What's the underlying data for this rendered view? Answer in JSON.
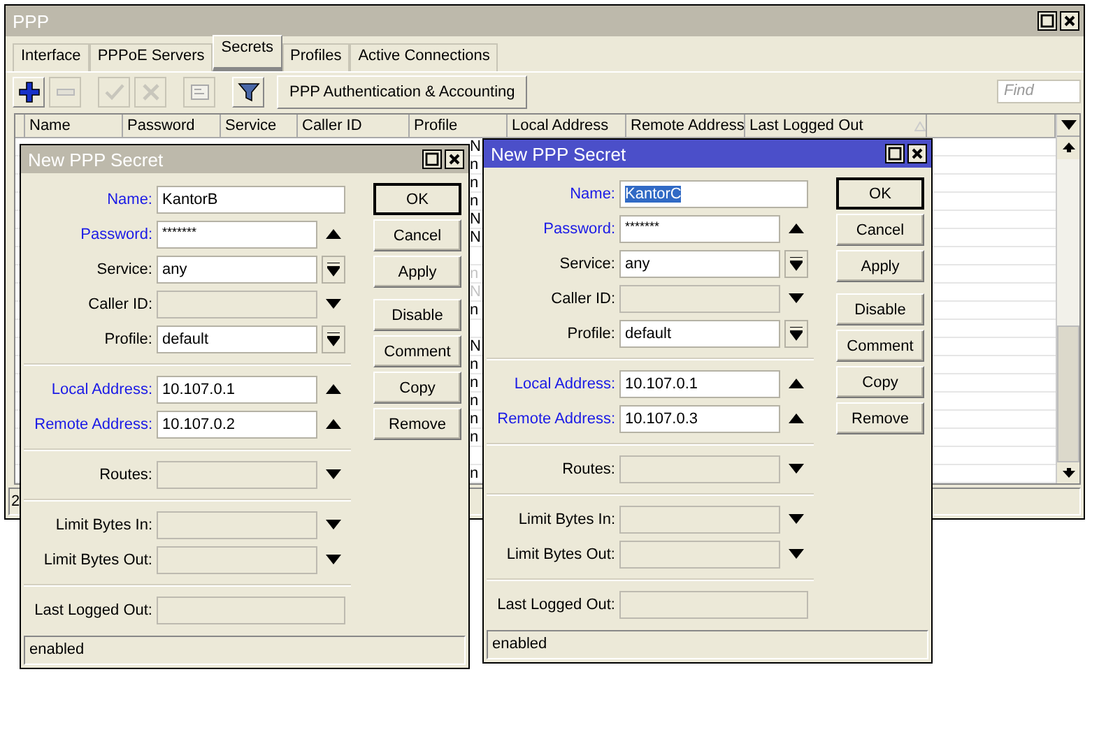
{
  "window": {
    "title": "PPP"
  },
  "tabs": [
    {
      "label": "Interface",
      "selected": false
    },
    {
      "label": "PPPoE Servers",
      "selected": false
    },
    {
      "label": "Secrets",
      "selected": true
    },
    {
      "label": "Profiles",
      "selected": false
    },
    {
      "label": "Active Connections",
      "selected": false
    }
  ],
  "toolbar": {
    "buttons": [
      {
        "kind": "add",
        "disabled": false
      },
      {
        "kind": "remove",
        "disabled": true
      },
      {
        "kind": "enable",
        "disabled": true
      },
      {
        "kind": "disable",
        "disabled": true
      },
      {
        "kind": "comment",
        "disabled": true
      },
      {
        "kind": "filter",
        "disabled": false
      }
    ],
    "action": "PPP Authentication & Accounting",
    "find": {
      "placeholder": "Find"
    }
  },
  "table": {
    "columns": [
      "Name",
      "Password",
      "Service",
      "Caller ID",
      "Profile",
      "Local Address",
      "Remote Address",
      "Last Logged Out"
    ],
    "rows": [
      {
        "profile": "N",
        "disabled": false
      },
      {
        "profile": "n",
        "disabled": false
      },
      {
        "profile": "n",
        "disabled": false
      },
      {
        "profile": "n",
        "disabled": false
      },
      {
        "profile": "N",
        "disabled": false
      },
      {
        "profile": "N",
        "disabled": false
      },
      {},
      {
        "profile": "n",
        "disabled": true
      },
      {
        "profile": "N",
        "disabled": true
      },
      {
        "profile": "n",
        "disabled": false
      },
      {},
      {
        "profile": "N",
        "disabled": false
      },
      {
        "profile": "n",
        "disabled": false
      },
      {
        "profile": "n",
        "disabled": false
      },
      {
        "profile": "n",
        "disabled": false
      },
      {
        "profile": "n",
        "disabled": false
      },
      {
        "profile": "n",
        "disabled": false
      },
      {},
      {
        "profile": "n",
        "disabled": false
      }
    ]
  },
  "status_bar": "2",
  "dialogs": [
    {
      "title": "New PPP Secret",
      "active": false,
      "sections": [
        [
          {
            "label": "Name:",
            "value": "KantorB",
            "kind": "text",
            "highlight": true,
            "selected": false
          },
          {
            "label": "Password:",
            "value": "*******",
            "kind": "password",
            "highlight": true,
            "selected": false
          },
          {
            "label": "Service:",
            "value": "any",
            "kind": "select",
            "highlight": false,
            "selected": false
          },
          {
            "label": "Caller ID:",
            "kind": "optional",
            "highlight": false
          },
          {
            "label": "Profile:",
            "value": "default",
            "kind": "select",
            "highlight": false,
            "selected": false
          }
        ],
        [
          {
            "label": "Local Address:",
            "value": "10.107.0.1",
            "kind": "password",
            "highlight": true,
            "selected": false
          },
          {
            "label": "Remote Address:",
            "value": "10.107.0.2",
            "kind": "password",
            "highlight": true,
            "selected": false
          }
        ],
        [
          {
            "label": "Routes:",
            "kind": "optional",
            "highlight": false
          }
        ],
        [
          {
            "label": "Limit Bytes In:",
            "kind": "optional",
            "highlight": false
          },
          {
            "label": "Limit Bytes Out:",
            "kind": "optional",
            "highlight": false
          }
        ],
        [
          {
            "label": "Last Logged Out:",
            "kind": "readonly",
            "highlight": false
          }
        ]
      ],
      "buttons": [
        {
          "label": "OK",
          "default": true
        },
        {
          "label": "Cancel",
          "default": false
        },
        {
          "label": "Apply",
          "default": false
        },
        {
          "label": "Disable",
          "default": false
        },
        {
          "label": "Comment",
          "default": false
        },
        {
          "label": "Copy",
          "default": false
        },
        {
          "label": "Remove",
          "default": false
        }
      ],
      "status": "enabled"
    },
    {
      "title": "New PPP Secret",
      "active": true,
      "sections": [
        [
          {
            "label": "Name:",
            "value": "KantorC",
            "kind": "text",
            "highlight": true,
            "selected": true
          },
          {
            "label": "Password:",
            "value": "*******",
            "kind": "password",
            "highlight": true,
            "selected": false
          },
          {
            "label": "Service:",
            "value": "any",
            "kind": "select",
            "highlight": false,
            "selected": false
          },
          {
            "label": "Caller ID:",
            "kind": "optional",
            "highlight": false
          },
          {
            "label": "Profile:",
            "value": "default",
            "kind": "select",
            "highlight": false,
            "selected": false
          }
        ],
        [
          {
            "label": "Local Address:",
            "value": "10.107.0.1",
            "kind": "password",
            "highlight": true,
            "selected": false
          },
          {
            "label": "Remote Address:",
            "value": "10.107.0.3",
            "kind": "password",
            "highlight": true,
            "selected": false
          }
        ],
        [
          {
            "label": "Routes:",
            "kind": "optional",
            "highlight": false
          }
        ],
        [
          {
            "label": "Limit Bytes In:",
            "kind": "optional",
            "highlight": false
          },
          {
            "label": "Limit Bytes Out:",
            "kind": "optional",
            "highlight": false
          }
        ],
        [
          {
            "label": "Last Logged Out:",
            "kind": "readonly",
            "highlight": false
          }
        ]
      ],
      "buttons": [
        {
          "label": "OK",
          "default": true
        },
        {
          "label": "Cancel",
          "default": false
        },
        {
          "label": "Apply",
          "default": false
        },
        {
          "label": "Disable",
          "default": false
        },
        {
          "label": "Comment",
          "default": false
        },
        {
          "label": "Copy",
          "default": false
        },
        {
          "label": "Remove",
          "default": false
        }
      ],
      "status": "enabled"
    }
  ]
}
